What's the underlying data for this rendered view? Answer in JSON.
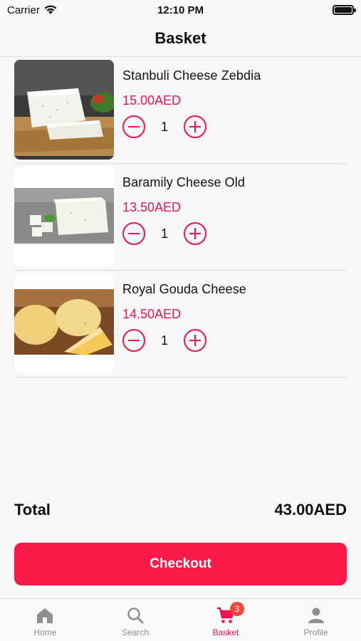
{
  "status_bar": {
    "carrier": "Carrier",
    "time": "12:10 PM"
  },
  "header": {
    "title": "Basket"
  },
  "items": [
    {
      "name": "Stanbuli Cheese Zebdia",
      "price": "15.00AED",
      "quantity": "1",
      "image": "cheese-block-on-board"
    },
    {
      "name": "Baramily Cheese Old",
      "price": "13.50AED",
      "quantity": "1",
      "image": "white-cheese-cubes"
    },
    {
      "name": "Royal Gouda Cheese",
      "price": "14.50AED",
      "quantity": "1",
      "image": "gouda-wheel-wedge"
    }
  ],
  "summary": {
    "total_label": "Total",
    "total_value": "43.00AED"
  },
  "checkout": {
    "label": "Checkout"
  },
  "tabs": [
    {
      "label": "Home",
      "icon": "home-icon",
      "active": false
    },
    {
      "label": "Search",
      "icon": "search-icon",
      "active": false
    },
    {
      "label": "Basket",
      "icon": "cart-icon",
      "active": true,
      "badge": "3"
    },
    {
      "label": "Profile",
      "icon": "person-icon",
      "active": false
    }
  ],
  "colors": {
    "accent": "#f0134d",
    "checkout": "#fa1a4a",
    "inactive": "#8e8e93"
  }
}
